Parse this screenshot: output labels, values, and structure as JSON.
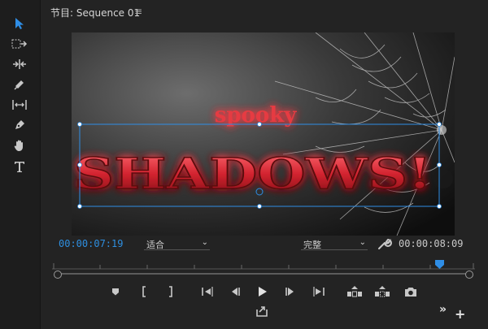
{
  "panel": {
    "title": "节目: Sequence 01",
    "menu_icon": "hamburger-icon"
  },
  "tools": [
    {
      "name": "selection-tool",
      "icon": "arrow-icon",
      "active": true
    },
    {
      "name": "track-select-tool",
      "icon": "track-select-icon"
    },
    {
      "name": "ripple-edit-tool",
      "icon": "ripple-edit-icon"
    },
    {
      "name": "razor-tool",
      "icon": "razor-icon"
    },
    {
      "name": "slip-tool",
      "icon": "slip-icon"
    },
    {
      "name": "pen-tool",
      "icon": "pen-icon"
    },
    {
      "name": "hand-tool",
      "icon": "hand-icon"
    },
    {
      "name": "type-tool",
      "icon": "type-icon"
    }
  ],
  "viewer": {
    "title_small": "spooky",
    "title_big": "SHADOWS!"
  },
  "timecode": {
    "current": "00:00:07:19",
    "duration": "00:00:08:09"
  },
  "fit": {
    "value": "适合"
  },
  "quality": {
    "value": "完整"
  },
  "transport": [
    "add-marker-button",
    "mark-in-button",
    "mark-out-button",
    "go-to-in-button",
    "step-back-button",
    "play-button",
    "step-forward-button",
    "go-to-out-button",
    "lift-button",
    "extract-button",
    "export-frame-button"
  ],
  "colors": {
    "accent_blue": "#2e8fe0",
    "title_red": "#d12a35",
    "glow": "#ff3b3b",
    "background": "#232323"
  }
}
